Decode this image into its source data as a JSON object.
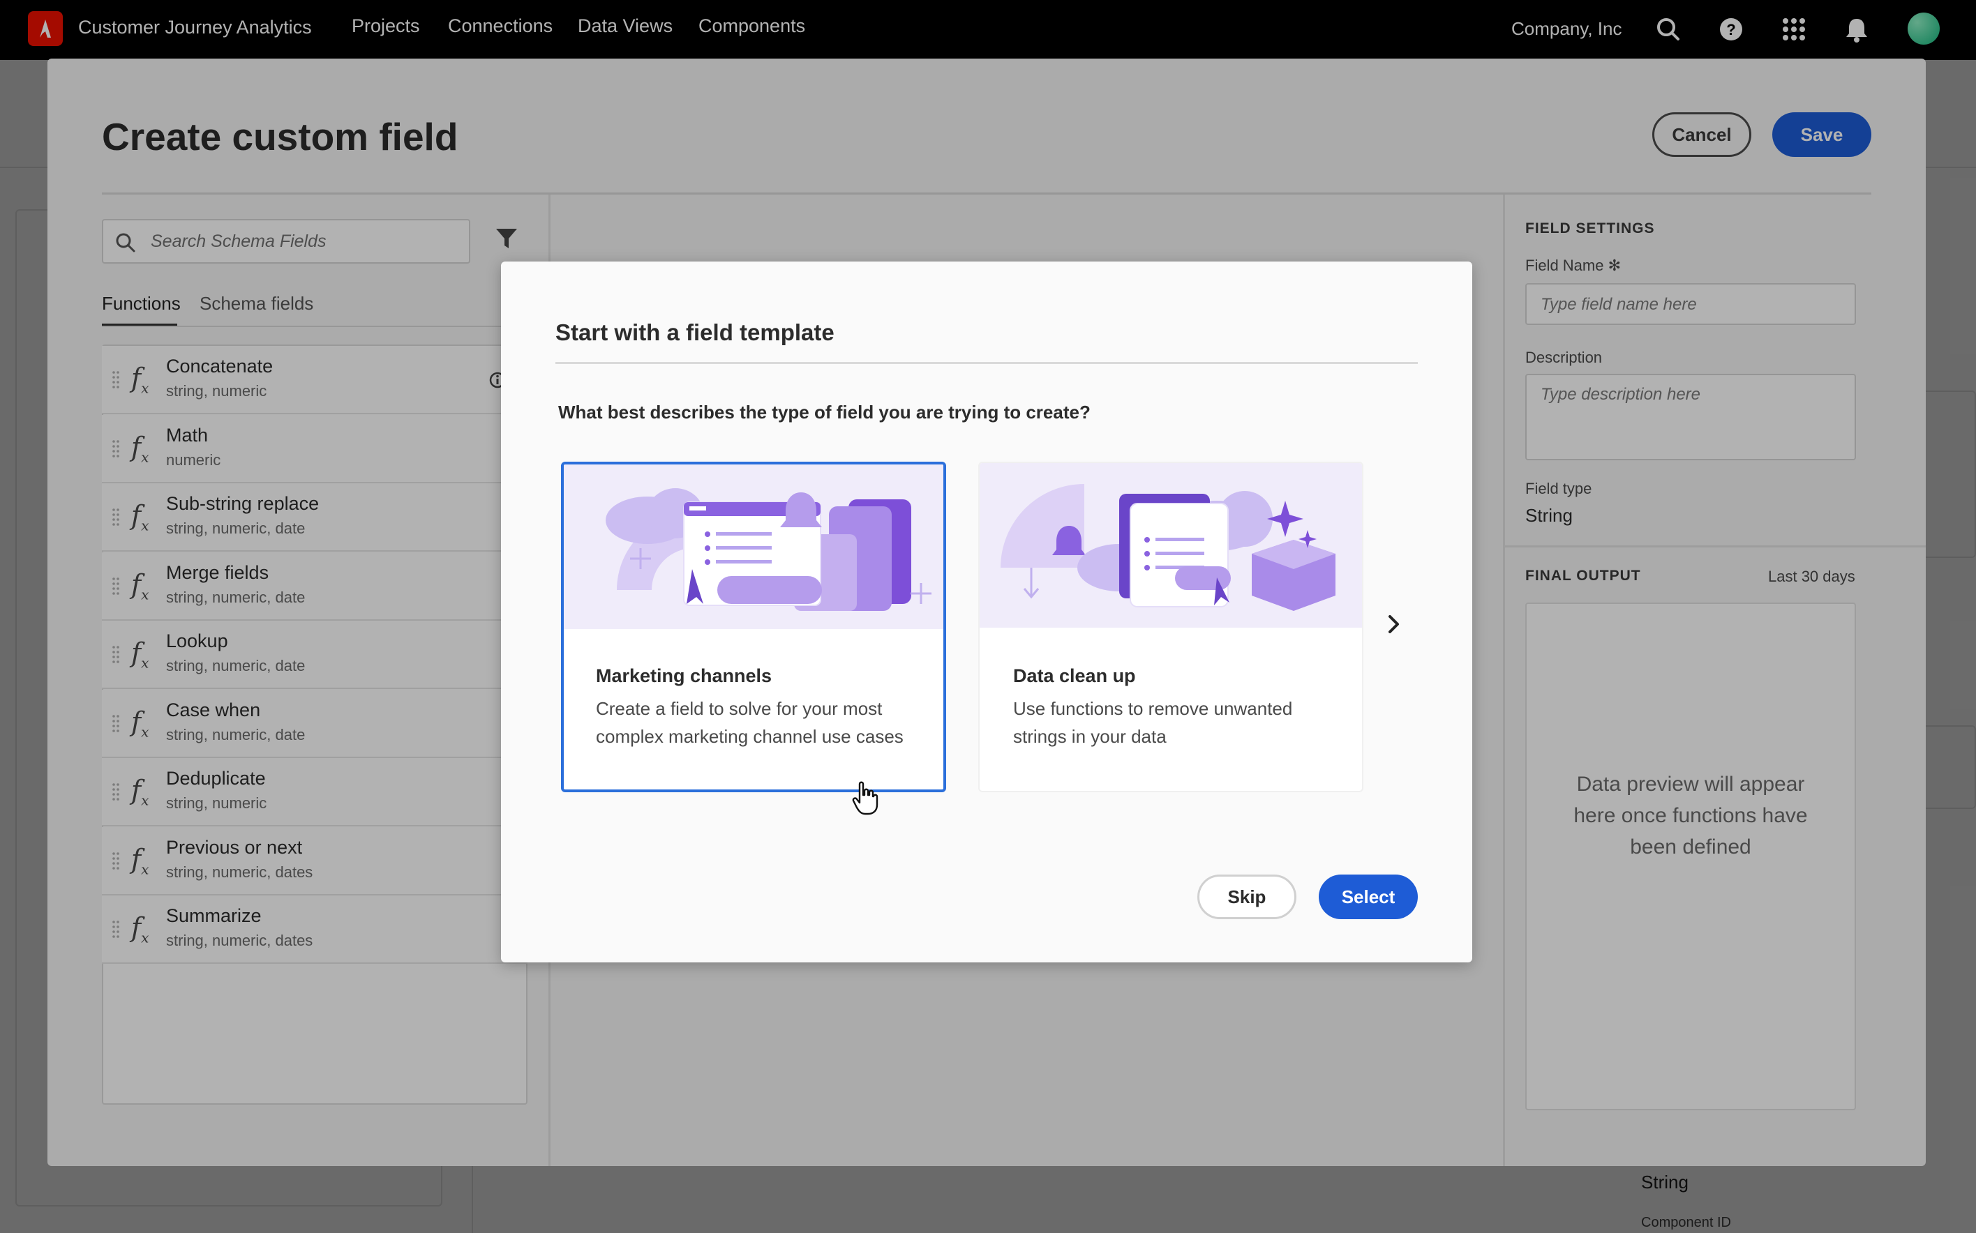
{
  "topnav": {
    "app_name": "Customer Journey Analytics",
    "links": [
      "Projects",
      "Connections",
      "Data Views",
      "Components"
    ],
    "company": "Company, Inc",
    "icons": [
      "search-icon",
      "help-icon",
      "apps-grid-icon",
      "bell-icon",
      "avatar"
    ]
  },
  "background": {
    "field_type": "String",
    "component_id_label": "Component ID"
  },
  "panel": {
    "title": "Create custom field",
    "cancel_label": "Cancel",
    "save_label": "Save",
    "search_placeholder": "Search Schema Fields",
    "tabs": [
      "Functions",
      "Schema fields"
    ],
    "functions": [
      {
        "name": "Concatenate",
        "types": "string, numeric"
      },
      {
        "name": "Math",
        "types": "numeric"
      },
      {
        "name": "Sub-string replace",
        "types": "string, numeric, date"
      },
      {
        "name": "Merge fields",
        "types": "string, numeric, date"
      },
      {
        "name": "Lookup",
        "types": "string, numeric, date"
      },
      {
        "name": "Case when",
        "types": "string, numeric, date"
      },
      {
        "name": "Deduplicate",
        "types": "string, numeric"
      },
      {
        "name": "Previous or next",
        "types": "string, numeric, dates"
      },
      {
        "name": "Summarize",
        "types": "string, numeric, dates"
      }
    ]
  },
  "field_settings": {
    "title": "FIELD SETTINGS",
    "field_name_label": "Field Name",
    "field_name_placeholder": "Type field name here",
    "description_label": "Description",
    "description_placeholder": "Type description here",
    "field_type_label": "Field type",
    "field_type_value": "String"
  },
  "final_output": {
    "title": "FINAL OUTPUT",
    "range": "Last 30 days",
    "preview_text": "Data preview will appear here once functions have been defined"
  },
  "modal": {
    "title": "Start with a field template",
    "question": "What best describes the type of field you are trying to create?",
    "cards": [
      {
        "title": "Marketing channels",
        "description": "Create a field to solve for your most complex marketing channel use cases",
        "selected": true
      },
      {
        "title": "Data clean up",
        "description": "Use functions to remove unwanted strings in your data",
        "selected": false
      }
    ],
    "skip_label": "Skip",
    "select_label": "Select"
  },
  "colors": {
    "accent": "#1e5cd6",
    "selected_border": "#2b6fdb",
    "adobe_red": "#eb1000",
    "illustration_purple": "#8a62e0"
  }
}
